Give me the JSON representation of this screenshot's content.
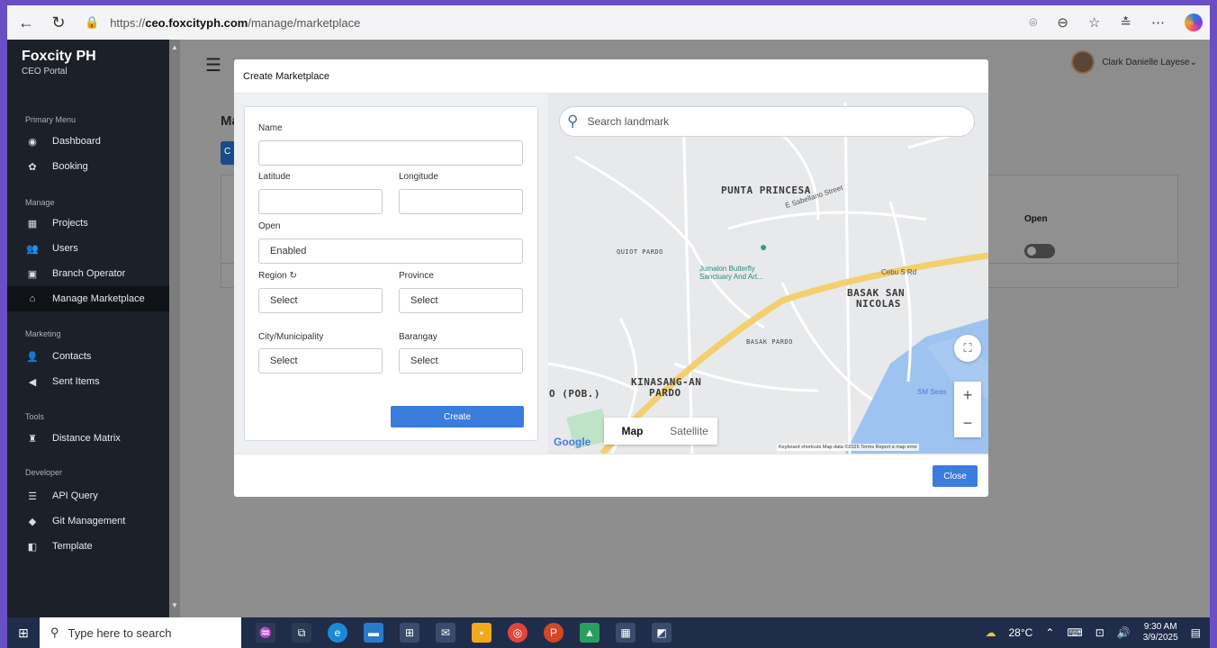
{
  "browser": {
    "url_prefix": "https://",
    "url_domain": "ceo.foxcityph.com",
    "url_path": "/manage/marketplace"
  },
  "sidebar": {
    "brand": "Foxcity PH",
    "subtitle": "CEO Portal",
    "sections": {
      "primary": "Primary Menu",
      "manage": "Manage",
      "marketing": "Marketing",
      "tools": "Tools",
      "developer": "Developer"
    },
    "items": {
      "dashboard": "Dashboard",
      "booking": "Booking",
      "projects": "Projects",
      "users": "Users",
      "branch_operator": "Branch Operator",
      "manage_marketplace": "Manage Marketplace",
      "contacts": "Contacts",
      "sent_items": "Sent Items",
      "distance_matrix": "Distance Matrix",
      "api_query": "API Query",
      "git_management": "Git Management",
      "template": "Template"
    }
  },
  "header": {
    "user_name": "Clark Danielle Layese"
  },
  "page": {
    "title_partial": "Ma",
    "button_partial": "C",
    "card_partial": "M",
    "open_header": "Open"
  },
  "modal": {
    "title": "Create Marketplace",
    "fields": {
      "name_label": "Name",
      "latitude_label": "Latitude",
      "longitude_label": "Longitude",
      "open_label": "Open",
      "open_value": "Enabled",
      "region_label": "Region",
      "province_label": "Province",
      "region_value": "Select",
      "province_value": "Select",
      "city_label": "City/Municipality",
      "barangay_label": "Barangay",
      "city_value": "Select",
      "barangay_value": "Select"
    },
    "create_button": "Create",
    "close_button": "Close"
  },
  "map": {
    "search_placeholder": "Search landmark",
    "labels": {
      "punta_princesa": "PUNTA PRINCESA",
      "quiot_pardo": "QUIOT PARDO",
      "basak_san": "BASAK SAN",
      "nicolas": "NICOLAS",
      "basak_pardo": "BASAK PARDO",
      "kinasang_an": "KINASANG-AN",
      "pardo": "PARDO",
      "pob": "O (POB.)",
      "poi": "Jumalon Butterfly Sanctuary And Art...",
      "sm_seaside": "SM Seas",
      "cebu_s_rd": "Cebu S Rd",
      "e_sabellano": "E Sabellano Street"
    },
    "map_type": "Map",
    "satellite_type": "Satellite",
    "google": "Google",
    "attribution": "Keyboard shortcuts   Map data ©2025   Terms   Report a map error"
  },
  "taskbar": {
    "search_placeholder": "Type here to search",
    "temperature": "28°C",
    "time": "9:30 AM",
    "date": "3/9/2025"
  }
}
